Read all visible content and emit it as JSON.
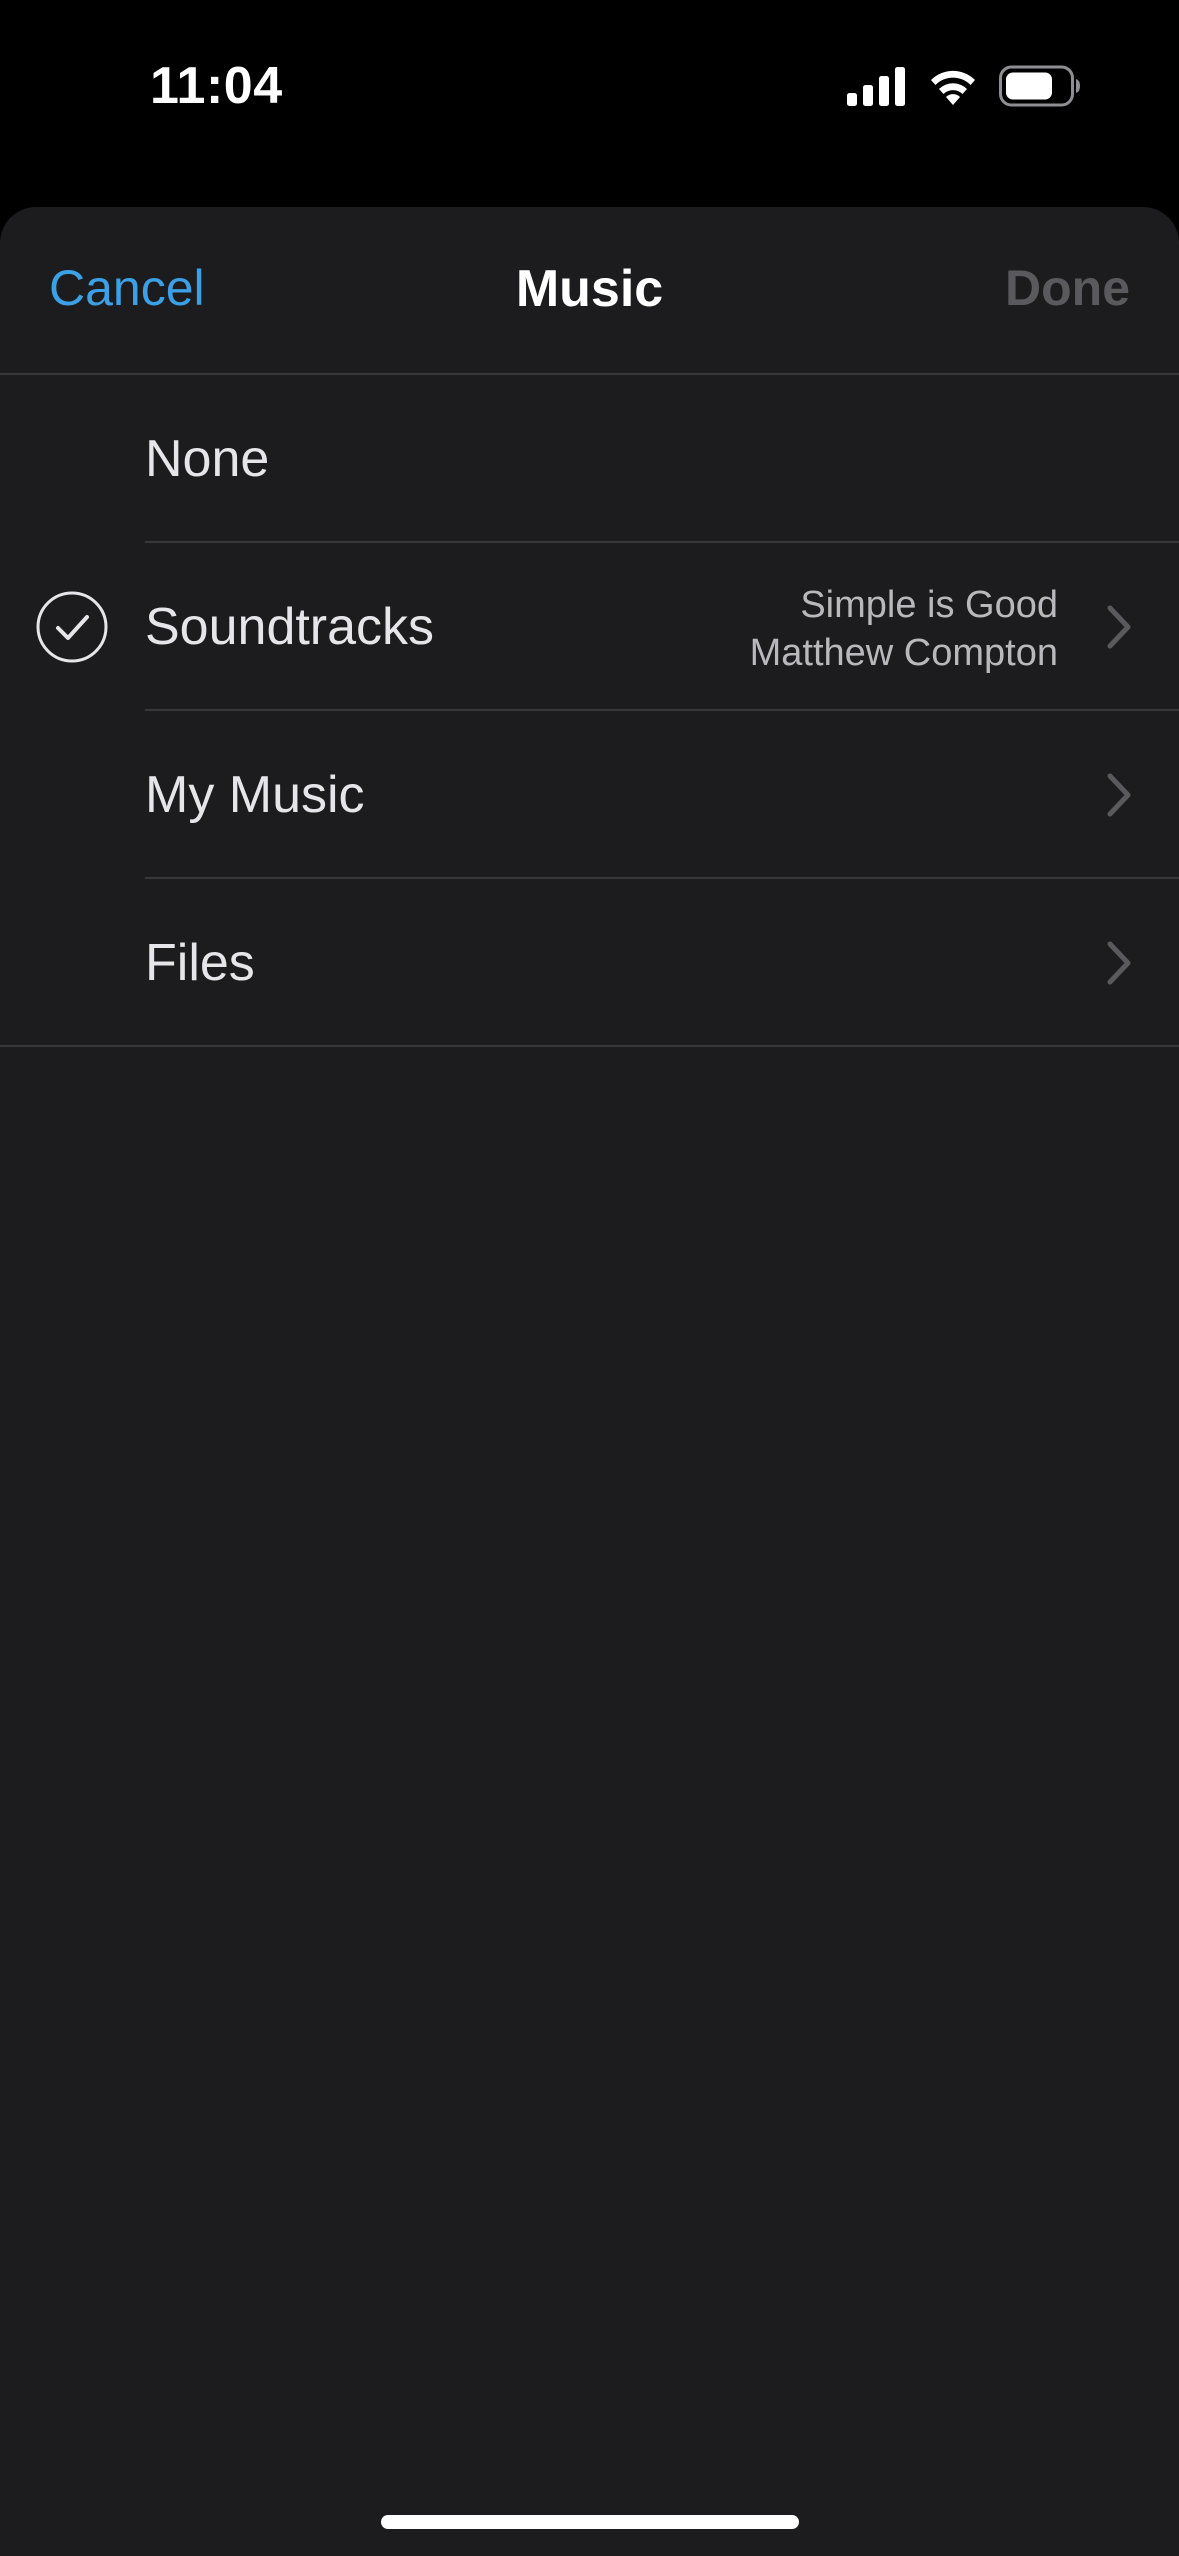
{
  "status_bar": {
    "time": "11:04"
  },
  "nav": {
    "cancel_label": "Cancel",
    "title": "Music",
    "done_label": "Done"
  },
  "list": {
    "items": [
      {
        "label": "None",
        "selected": false,
        "detail_title": "",
        "detail_subtitle": "",
        "has_chevron": false
      },
      {
        "label": "Soundtracks",
        "selected": true,
        "detail_title": "Simple is Good",
        "detail_subtitle": "Matthew Compton",
        "has_chevron": true
      },
      {
        "label": "My Music",
        "selected": false,
        "detail_title": "",
        "detail_subtitle": "",
        "has_chevron": true
      },
      {
        "label": "Files",
        "selected": false,
        "detail_title": "",
        "detail_subtitle": "",
        "has_chevron": true
      }
    ]
  },
  "colors": {
    "accent": "#3ba0e6",
    "sheet_background": "#1c1c1e",
    "separator": "#38383a",
    "disabled_text": "#5a5a5e"
  },
  "icons": {
    "check": "checkmark-circle-icon",
    "chevron": "chevron-right-icon",
    "signal": "cellular-signal-icon",
    "wifi": "wifi-icon",
    "battery": "battery-icon"
  }
}
